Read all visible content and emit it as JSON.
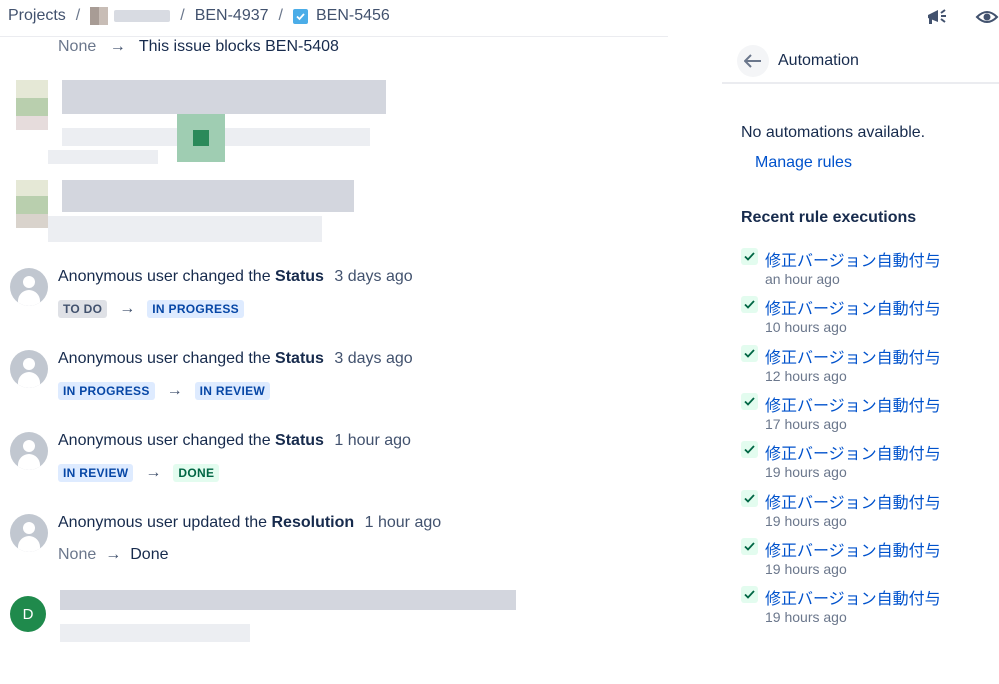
{
  "breadcrumb": {
    "projects": "Projects",
    "sep": "/",
    "parent_issue": "BEN-4937",
    "current_issue": "BEN-5456"
  },
  "link": {
    "from": "None",
    "to": "This issue blocks BEN-5408"
  },
  "history": [
    {
      "user": "Anonymous user",
      "verb": "changed the",
      "field": "Status",
      "when": "3 days ago",
      "from": "TO DO",
      "to": "IN PROGRESS"
    },
    {
      "user": "Anonymous user",
      "verb": "changed the",
      "field": "Status",
      "when": "3 days ago",
      "from": "IN PROGRESS",
      "to": "IN REVIEW"
    },
    {
      "user": "Anonymous user",
      "verb": "changed the",
      "field": "Status",
      "when": "1 hour ago",
      "from": "IN REVIEW",
      "to": "DONE"
    },
    {
      "user": "Anonymous user",
      "verb": "updated the",
      "field": "Resolution",
      "when": "1 hour ago",
      "from": "None",
      "to": "Done"
    }
  ],
  "last_avatar_initial": "D",
  "automation": {
    "title": "Automation",
    "empty": "No automations available.",
    "manage": "Manage rules",
    "recent_heading": "Recent rule executions",
    "executions": [
      {
        "rule": "修正バージョン自動付与",
        "ago": "an hour ago"
      },
      {
        "rule": "修正バージョン自動付与",
        "ago": "10 hours ago"
      },
      {
        "rule": "修正バージョン自動付与",
        "ago": "12 hours ago"
      },
      {
        "rule": "修正バージョン自動付与",
        "ago": "17 hours ago"
      },
      {
        "rule": "修正バージョン自動付与",
        "ago": "19 hours ago"
      },
      {
        "rule": "修正バージョン自動付与",
        "ago": "19 hours ago"
      },
      {
        "rule": "修正バージョン自動付与",
        "ago": "19 hours ago"
      },
      {
        "rule": "修正バージョン自動付与",
        "ago": "19 hours ago"
      }
    ]
  },
  "colors": {
    "link": "#0052cc",
    "text": "#172b4d",
    "muted": "#6b778c",
    "avatar_d": "#1f8a4c"
  }
}
